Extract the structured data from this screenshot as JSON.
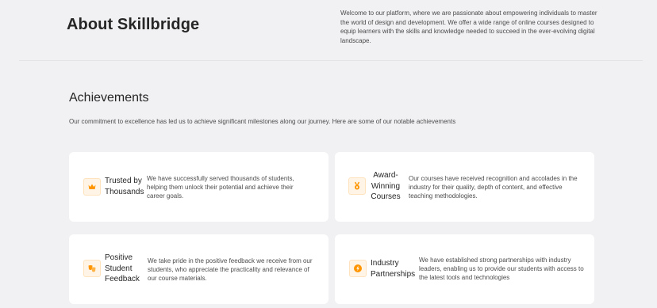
{
  "header": {
    "title": "About Skillbridge",
    "intro": "Welcome to our platform, where we are passionate about empowering individuals to master the world of design and development. We offer a wide range of online courses designed to equip learners with the skills and knowledge needed to succeed in the ever-evolving digital landscape."
  },
  "achievements": {
    "title": "Achievements",
    "subtitle": "Our commitment to excellence has led us to achieve significant milestones along our journey. Here are some of our notable achievements",
    "accent_color": "#ff9500",
    "cards": [
      {
        "icon": "crown-icon",
        "title": "Trusted by Thousands",
        "description": "We have successfully served thousands of students, helping them unlock their potential and achieve their career goals."
      },
      {
        "icon": "medal-icon",
        "title": "Award-Winning Courses",
        "description": "Our courses have received recognition and accolades in the industry for their quality, depth of content, and effective teaching methodologies."
      },
      {
        "icon": "masks-icon",
        "title": "Positive Student Feedback",
        "description": "We take pride in the positive feedback we receive from our students, who appreciate the practicality and relevance of our course materials."
      },
      {
        "icon": "lightning-icon",
        "title": "Industry Partnerships",
        "description": "We have established strong partnerships with industry leaders, enabling us to provide our students with access to the latest tools and technologies"
      }
    ]
  }
}
